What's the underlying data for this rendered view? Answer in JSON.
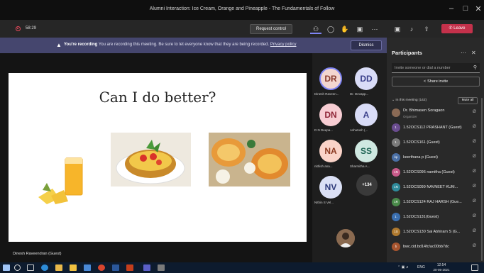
{
  "window": {
    "title": "Alumni Interaction: Ice Cream, Orange and Pineapple - The Fundamentals of Follow"
  },
  "meeting_bar": {
    "timer": "58:29",
    "request_control": "Request control",
    "leave": "Leave"
  },
  "banner": {
    "bold": "You're recording",
    "text": "You are recording this meeting. Be sure to let everyone know that they are being recorded.",
    "link": "Privacy policy",
    "dismiss": "Dismiss"
  },
  "slide": {
    "title": "Can I do better?"
  },
  "presenter": "Dinesh Raveendran (Guest)",
  "gallery": [
    {
      "initials": "DR",
      "name": "Dinesh Raveen...",
      "bg": "#f3d6cf",
      "fg": "#8a3b2e"
    },
    {
      "initials": "DD",
      "name": "Dr. Devapp...",
      "bg": "#d9dcf7",
      "fg": "#3a3f8a"
    },
    {
      "initials": "DN",
      "name": "D N Deepa...",
      "bg": "#f7cdd3",
      "fg": "#8e2437"
    },
    {
      "initials": "A",
      "name": "Ashutosh (...",
      "bg": "#d9dcf7",
      "fg": "#3a3f8a"
    },
    {
      "initials": "NA",
      "name": "nithish ana...",
      "bg": "#fad3c8",
      "fg": "#8c3a22"
    },
    {
      "initials": "SS",
      "name": "Sharmitha A...",
      "bg": "#cfe8e1",
      "fg": "#1f6454"
    },
    {
      "initials": "NV",
      "name": "Nithin S Vel...",
      "bg": "#dbe0f5",
      "fg": "#2f3b7a"
    }
  ],
  "gallery_more": "+134",
  "panel": {
    "title": "Participants",
    "invite_placeholder": "Invite someone or dial a number",
    "share_invite": "Share invite",
    "section": "In this meeting (142)",
    "mute_all": "Mute all",
    "participants": [
      {
        "name": "Dr. Bhimasen Soragaon",
        "sub": "Organizer",
        "initials": "",
        "color": "#8a6a55"
      },
      {
        "name": "1.52OCS112 PRASHANT (Guest)",
        "sub": "",
        "initials": "1.",
        "color": "#6a4c8f"
      },
      {
        "name": "1.52OCS161 (Guest)",
        "sub": "",
        "initials": "1.",
        "color": "#7a7a7a"
      },
      {
        "name": "keerthana p (Guest)",
        "sub": "",
        "initials": "kp",
        "color": "#4a6fa5"
      },
      {
        "name": "1.52OCS096 namitha (Guest)",
        "sub": "",
        "initials": "1N",
        "color": "#c85a8a"
      },
      {
        "name": "1.52OCS099 NAVNEET KUM...",
        "sub": "",
        "initials": "1N",
        "color": "#2f8a9a"
      },
      {
        "name": "1.52OCS124 RAJ HARSH (Gue...",
        "sub": "",
        "initials": "1R",
        "color": "#4a8a4a"
      },
      {
        "name": "1.52OCS131(Guest)",
        "sub": "",
        "initials": "1.",
        "color": "#3a6fb0"
      },
      {
        "name": "1.52OCS130 Sai Abhiram S (G...",
        "sub": "",
        "initials": "1S",
        "color": "#b07a2f"
      },
      {
        "name": "bwc.cid.bd14fc/ac00bb7dc",
        "sub": "",
        "initials": "b",
        "color": "#a8552f"
      }
    ]
  },
  "taskbar": {
    "lang": "ENG",
    "time": "12:54",
    "date": "20-05-2021"
  }
}
